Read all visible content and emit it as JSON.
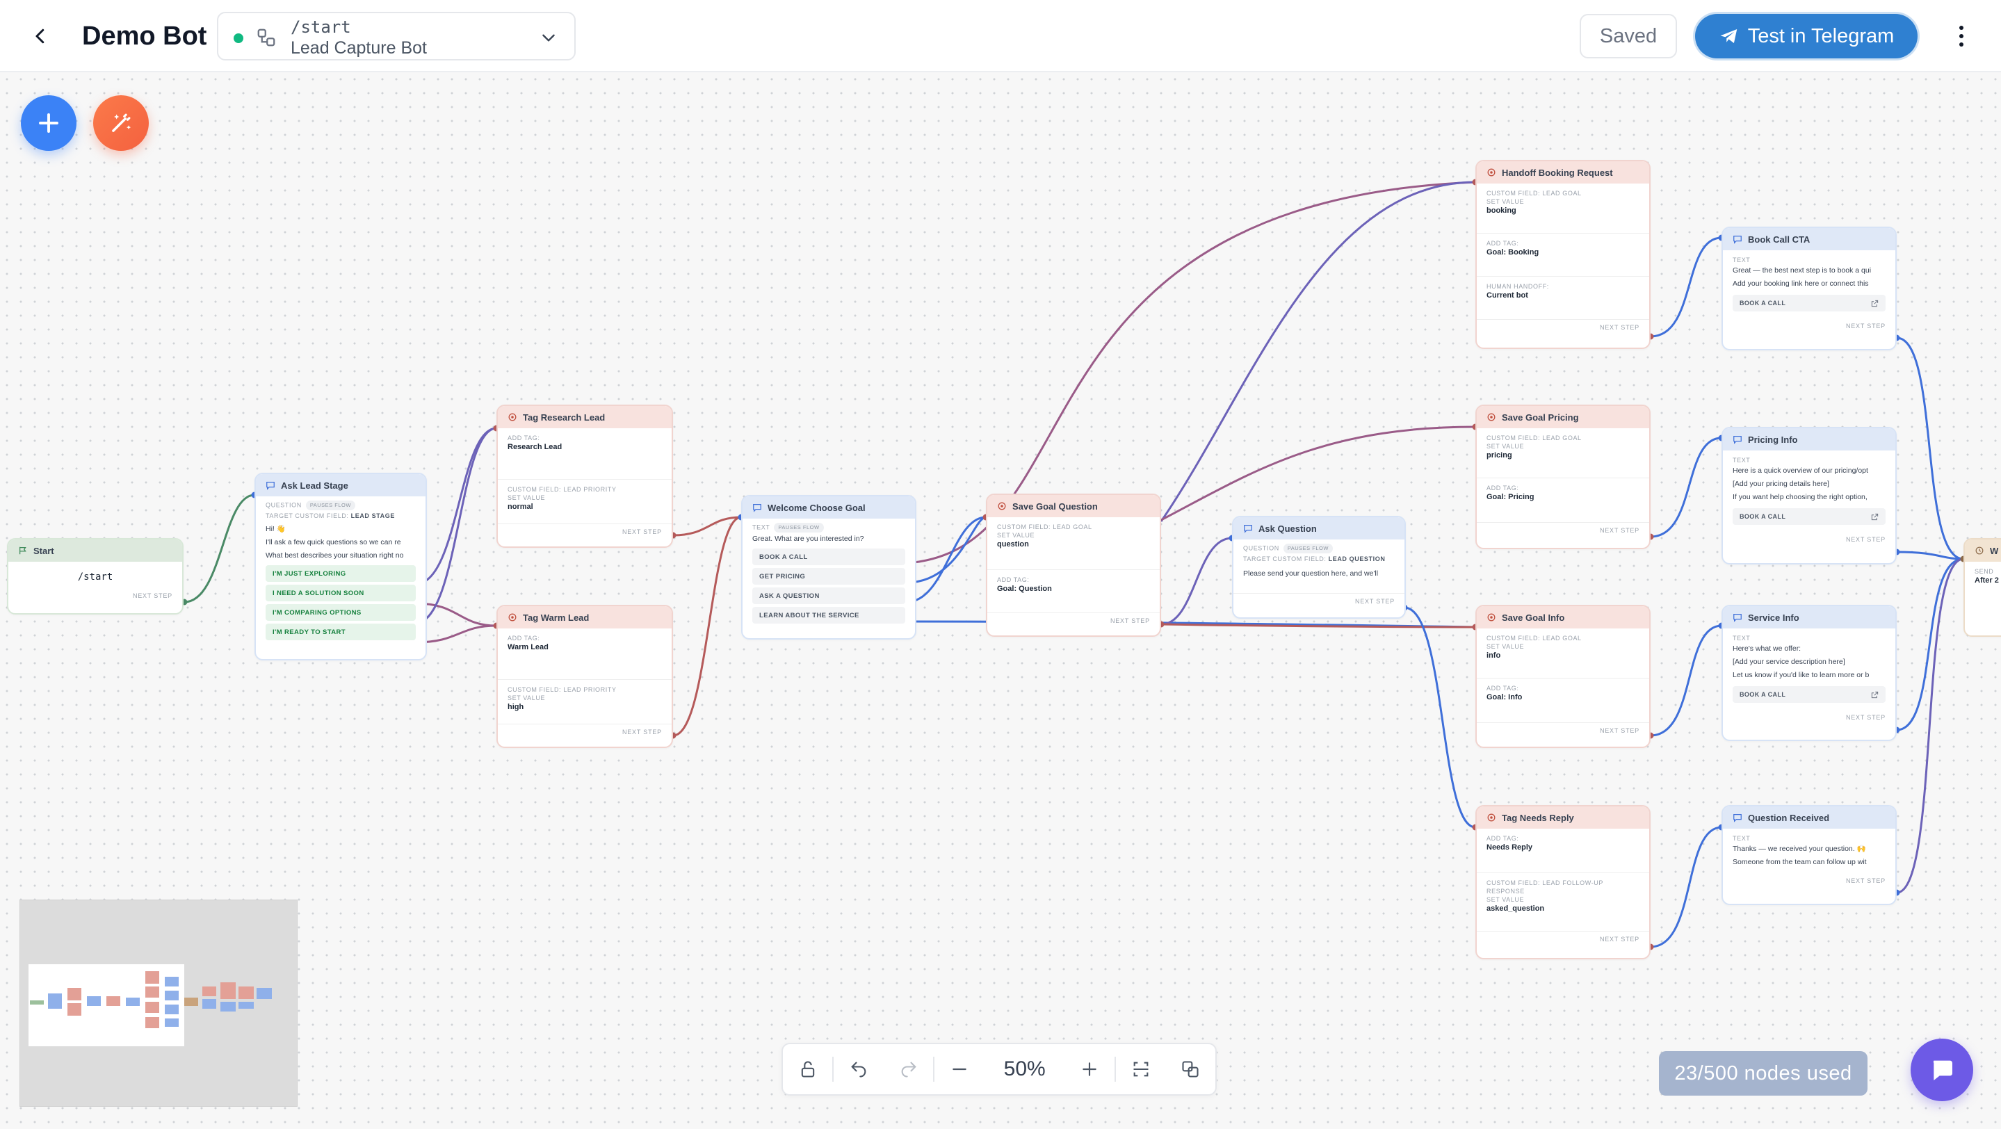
{
  "header": {
    "back_label": "Back",
    "bot_name": "Demo Bot",
    "flow_command": "/start",
    "flow_name": "Lead Capture Bot",
    "flow_status_color": "#10b981",
    "saved_label": "Saved",
    "test_button_label": "Test in Telegram"
  },
  "colors": {
    "accent_blue": "#2f80d1",
    "add_button": "#3b82f6",
    "magic_button": "#f4613f",
    "edge_red": "#b55a5a",
    "edge_blue": "#3f6fd9",
    "edge_green": "#3f8a5a",
    "chat_button": "#6d5ae6"
  },
  "icons": {
    "back": "chevron-left-icon",
    "flow": "flow-branch-icon",
    "dropdown": "chevron-down-icon",
    "telegram": "telegram-plane-icon",
    "menu": "kebab-menu-icon",
    "add": "plus-icon",
    "magic": "magic-wand-icon",
    "chat": "chat-bubble-icon"
  },
  "nodes": {
    "start": {
      "title": "Start",
      "command": "/start",
      "next": "NEXT STEP"
    },
    "ask_lead_stage": {
      "title": "Ask Lead Stage",
      "q_label": "QUESTION",
      "pauses": "PAUSES FLOW",
      "target_label": "TARGET CUSTOM FIELD:",
      "target_value": "LEAD STAGE",
      "line1": "Hi! 👋",
      "line2": "I'll ask a few quick questions so we can re",
      "line3": "What best describes your situation right no",
      "options": [
        "I'M JUST EXPLORING",
        "I NEED A SOLUTION SOON",
        "I'M COMPARING OPTIONS",
        "I'M READY TO START"
      ]
    },
    "tag_research": {
      "title": "Tag Research Lead",
      "l1": "ADD TAG:",
      "v1": "Research Lead",
      "l2": "CUSTOM FIELD: LEAD PRIORITY",
      "l3": "SET VALUE",
      "v2": "normal",
      "next": "NEXT STEP"
    },
    "tag_warm": {
      "title": "Tag Warm Lead",
      "l1": "ADD TAG:",
      "v1": "Warm Lead",
      "l2": "CUSTOM FIELD: LEAD PRIORITY",
      "l3": "SET VALUE",
      "v2": "high",
      "next": "NEXT STEP"
    },
    "welcome": {
      "title": "Welcome Choose Goal",
      "t_label": "TEXT",
      "pauses": "PAUSES FLOW",
      "text": "Great. What are you interested in?",
      "options": [
        "BOOK A CALL",
        "GET PRICING",
        "ASK A QUESTION",
        "LEARN ABOUT THE SERVICE"
      ]
    },
    "save_question": {
      "title": "Save Goal Question",
      "l1": "CUSTOM FIELD: LEAD GOAL",
      "l2": "SET VALUE",
      "v1": "question",
      "l3": "ADD TAG:",
      "v2": "Goal: Question",
      "next": "NEXT STEP"
    },
    "ask_question": {
      "title": "Ask Question",
      "q_label": "QUESTION",
      "pauses": "PAUSES FLOW",
      "target_label": "TARGET CUSTOM FIELD:",
      "target_value": "LEAD QUESTION",
      "text": "Please send your question here, and we'll",
      "next": "NEXT STEP"
    },
    "handoff": {
      "title": "Handoff Booking Request",
      "l1": "CUSTOM FIELD: LEAD GOAL",
      "l2": "SET VALUE",
      "v1": "booking",
      "l3": "ADD TAG:",
      "v2": "Goal: Booking",
      "l4": "HUMAN HANDOFF:",
      "v3": "Current bot",
      "next": "NEXT STEP"
    },
    "save_pricing": {
      "title": "Save Goal Pricing",
      "l1": "CUSTOM FIELD: LEAD GOAL",
      "l2": "SET VALUE",
      "v1": "pricing",
      "l3": "ADD TAG:",
      "v2": "Goal: Pricing",
      "next": "NEXT STEP"
    },
    "save_info": {
      "title": "Save Goal Info",
      "l1": "CUSTOM FIELD: LEAD GOAL",
      "l2": "SET VALUE",
      "v1": "info",
      "l3": "ADD TAG:",
      "v2": "Goal: Info",
      "next": "NEXT STEP"
    },
    "tag_needs_reply": {
      "title": "Tag Needs Reply",
      "l1": "ADD TAG:",
      "v1": "Needs Reply",
      "l2": "CUSTOM FIELD: LEAD FOLLOW-UP",
      "l2b": "RESPONSE",
      "l3": "SET VALUE",
      "v2": "asked_question",
      "next": "NEXT STEP"
    },
    "book_call_cta": {
      "title": "Book Call CTA",
      "t_label": "TEXT",
      "line1": "Great — the best next step is to book a qui",
      "line2": "Add your booking link here or connect this",
      "cta": "BOOK A CALL",
      "next": "NEXT STEP"
    },
    "pricing_info": {
      "title": "Pricing Info",
      "t_label": "TEXT",
      "line1": "Here is a quick overview of our pricing/opt",
      "line2": "[Add your pricing details here]",
      "line3": "If you want help choosing the right option,",
      "cta": "BOOK A CALL",
      "next": "NEXT STEP"
    },
    "service_info": {
      "title": "Service Info",
      "t_label": "TEXT",
      "line1": "Here's what we offer:",
      "line2": "[Add your service description here]",
      "line3": "Let us know if you'd like to learn more or b",
      "cta": "BOOK A CALL",
      "next": "NEXT STEP"
    },
    "question_received": {
      "title": "Question Received",
      "t_label": "TEXT",
      "line1": "Thanks — we received your question. 🙌",
      "line2": "Someone from the team can follow up wit",
      "next": "NEXT STEP"
    },
    "wait": {
      "title": "W",
      "l1": "SEND",
      "v1": "After 2"
    }
  },
  "toolbar": {
    "zoom": "50%"
  },
  "quota": "23/500 nodes used"
}
